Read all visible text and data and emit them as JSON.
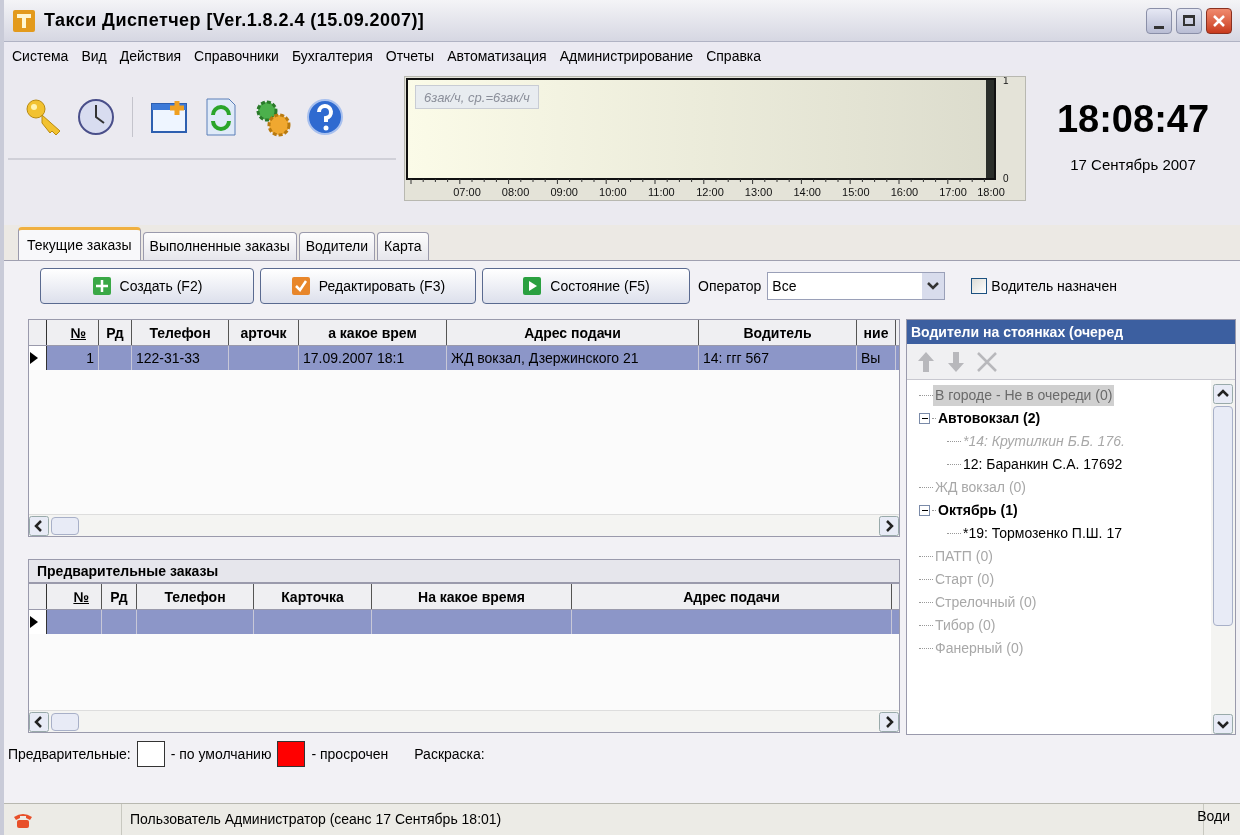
{
  "window": {
    "title": "Такси Диспетчер [Ver.1.8.2.4  (15.09.2007)]"
  },
  "menu": [
    "Система",
    "Вид",
    "Действия",
    "Справочники",
    "Бухгалтерия",
    "Отчеты",
    "Автоматизация",
    "Администрирование",
    "Справка"
  ],
  "activity": {
    "caption": "6зак/ч, ср.=6зак/ч",
    "chart_data": {
      "type": "bar",
      "categories": [
        "07:00",
        "08:00",
        "09:00",
        "10:00",
        "11:00",
        "12:00",
        "13:00",
        "14:00",
        "15:00",
        "16:00",
        "17:00",
        "18:00"
      ],
      "values": [
        0,
        0,
        0,
        0,
        0,
        0,
        0,
        0,
        0,
        0,
        0,
        1
      ],
      "yticks": [
        0,
        1
      ],
      "ylim": [
        0,
        1
      ]
    }
  },
  "clock": {
    "time": "18:08:47",
    "date": "17 Сентябрь 2007"
  },
  "tabs": [
    {
      "label": "Текущие заказы",
      "selected": true
    },
    {
      "label": "Выполненные заказы",
      "selected": false
    },
    {
      "label": "Водители",
      "selected": false
    },
    {
      "label": "Карта",
      "selected": false
    }
  ],
  "actions": [
    {
      "label": "Создать (F2)",
      "kind": "create"
    },
    {
      "label": "Редактировать (F3)",
      "kind": "edit"
    },
    {
      "label": "Состояние (F5)",
      "kind": "state"
    }
  ],
  "operator": {
    "label": "Оператор",
    "value": "Все"
  },
  "driver_assigned": {
    "label": "Водитель назначен",
    "checked": false
  },
  "orders": {
    "columns": [
      "№",
      "Рд",
      "Телефон",
      "арточк",
      "а какое врем",
      "Адрес подачи",
      "Водитель",
      "ние"
    ],
    "rows": [
      {
        "selected": true,
        "cells": [
          "1",
          "",
          "122-31-33",
          "",
          "17.09.2007 18:1",
          "ЖД вокзал, Дзержинского 21",
          "14: ггг 567",
          "Вы"
        ]
      }
    ]
  },
  "preliminary": {
    "title": "Предварительные заказы",
    "columns": [
      "№",
      "Рд",
      "Телефон",
      "Карточка",
      "На какое время",
      "Адрес подачи"
    ],
    "rows": [
      {
        "selected": true
      }
    ]
  },
  "legend": {
    "label": "Предварительные:",
    "items": [
      {
        "label": "- по умолчанию",
        "color": "#ffffff"
      },
      {
        "label": "- просрочен",
        "color": "#ff0000"
      }
    ],
    "coloring": "Раскраска:"
  },
  "drivers_panel": {
    "title": "Водители на стоянках (очеред",
    "tree": [
      {
        "label": "В городе - Не в очереди (0)",
        "kind": "empty",
        "selected": true
      },
      {
        "label": "Автовокзал (2)",
        "kind": "stop",
        "selected": false,
        "expanded": true,
        "children": [
          {
            "label": "*14: Крутилкин Б.Б. 176.",
            "kind": "busy",
            "selected": false
          },
          {
            "label": "12: Баранкин С.А. 17692",
            "kind": "driver",
            "selected": false
          }
        ]
      },
      {
        "label": "ЖД вокзал (0)",
        "kind": "empty",
        "selected": false
      },
      {
        "label": "Октябрь (1)",
        "kind": "stop",
        "selected": false,
        "expanded": true,
        "children": [
          {
            "label": "*19: Тормозенко П.Ш. 17",
            "kind": "driver",
            "selected": false
          }
        ]
      },
      {
        "label": "ПАТП (0)",
        "kind": "empty",
        "selected": false
      },
      {
        "label": "Старт (0)",
        "kind": "empty",
        "selected": false
      },
      {
        "label": "Стрелочный (0)",
        "kind": "empty",
        "selected": false
      },
      {
        "label": "Тибор (0)",
        "kind": "empty",
        "selected": false
      },
      {
        "label": "Фанерный (0)",
        "kind": "empty",
        "selected": false
      }
    ]
  },
  "status_bar": {
    "user": "Пользователь Администратор  (сеанс  17 Сентябрь  18:01)",
    "right": "Води"
  }
}
